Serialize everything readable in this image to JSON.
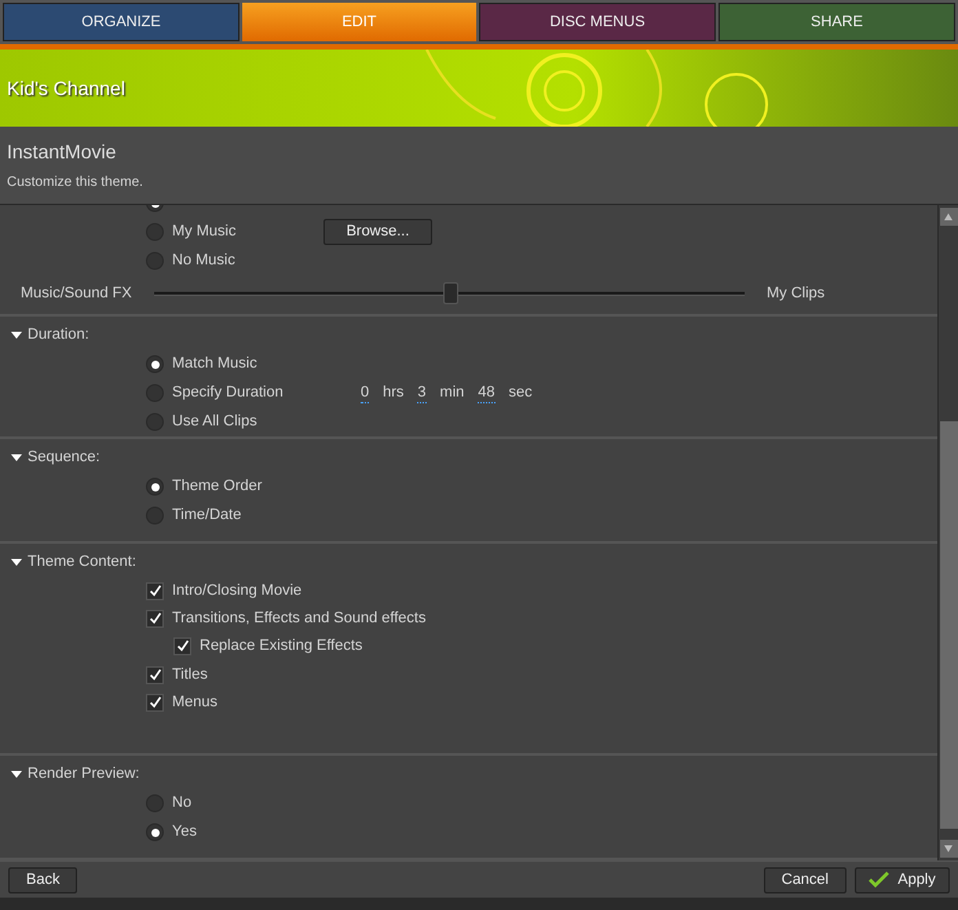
{
  "tabs": [
    {
      "label": "ORGANIZE",
      "selected": false,
      "color": "#2c4a72"
    },
    {
      "label": "EDIT",
      "selected": true,
      "color": "#f08a10"
    },
    {
      "label": "DISC MENUS",
      "selected": false,
      "color": "#5a2846"
    },
    {
      "label": "SHARE",
      "selected": false,
      "color": "#3d6235"
    }
  ],
  "banner": {
    "title": "Kid's Channel"
  },
  "header": {
    "title": "InstantMovie",
    "subtitle": "Customize this theme."
  },
  "sections": [
    {
      "items": [
        {
          "kind": "radio",
          "selected": true
        },
        {
          "kind": "radio",
          "label": "My Music",
          "selected": false,
          "button": "Browse..."
        },
        {
          "kind": "radio",
          "label": "No Music",
          "selected": false
        },
        {
          "kind": "slider",
          "left_label": "Music/Sound FX",
          "right_label": "My Clips",
          "level": 0.5
        }
      ]
    },
    {
      "heading": "Duration:",
      "expanded": true,
      "items": [
        {
          "kind": "radio",
          "label": "Match Music",
          "selected": true
        },
        {
          "kind": "radio",
          "label": "Specify Duration",
          "selected": false,
          "fields": [
            {
              "value": "0",
              "unit": "hrs"
            },
            {
              "value": "3",
              "unit": "min"
            },
            {
              "value": "48",
              "unit": "sec"
            }
          ]
        },
        {
          "kind": "radio",
          "label": "Use All Clips",
          "selected": false
        }
      ]
    },
    {
      "heading": "Sequence:",
      "expanded": true,
      "items": [
        {
          "kind": "radio",
          "label": "Theme Order",
          "selected": true
        },
        {
          "kind": "radio",
          "label": "Time/Date",
          "selected": false
        }
      ]
    },
    {
      "heading": "Theme Content:",
      "expanded": true,
      "items": [
        {
          "kind": "checkbox",
          "label": "Intro/Closing Movie",
          "checked": true
        },
        {
          "kind": "checkbox",
          "label": "Transitions, Effects and Sound effects",
          "checked": true,
          "children": [
            {
              "kind": "checkbox",
              "label": "Replace Existing Effects",
              "checked": true
            }
          ]
        },
        {
          "kind": "checkbox",
          "label": "Titles",
          "checked": true
        },
        {
          "kind": "checkbox",
          "label": "Menus",
          "checked": true
        }
      ]
    },
    {
      "heading": "Render Preview:",
      "expanded": true,
      "items": [
        {
          "kind": "radio",
          "label": "No",
          "selected": false
        },
        {
          "kind": "radio",
          "label": "Yes",
          "selected": true
        }
      ]
    }
  ],
  "footer": {
    "back": "Back",
    "cancel": "Cancel",
    "apply": "Apply"
  }
}
